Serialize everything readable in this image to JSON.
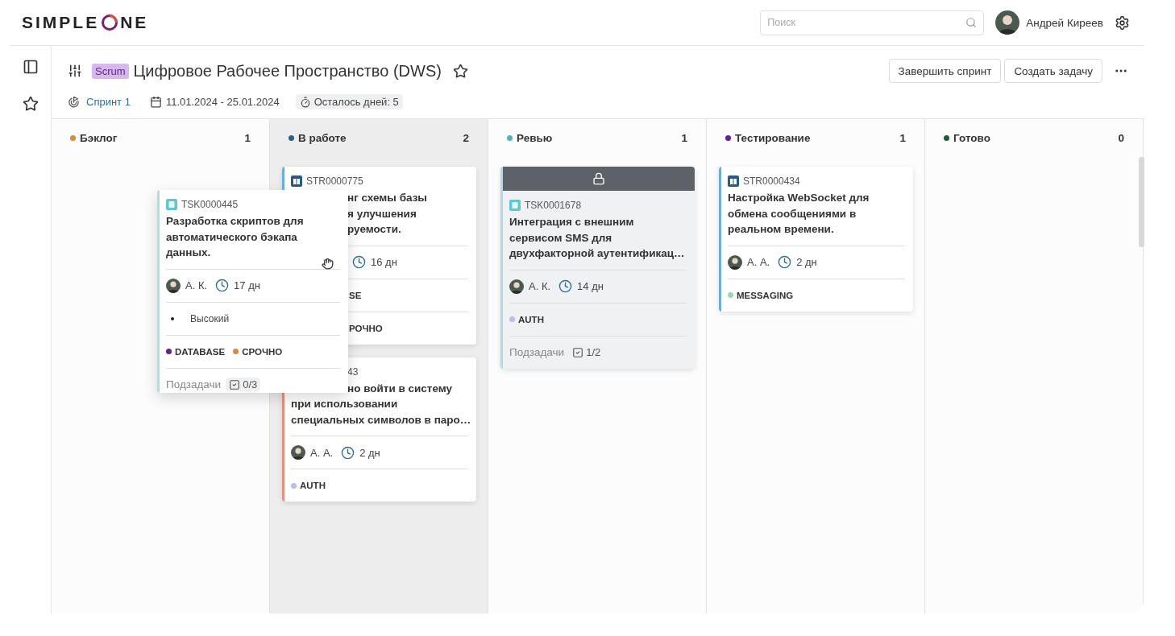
{
  "logo": {
    "before": "SIMPLE",
    "after": "NE"
  },
  "search": {
    "placeholder": "Поиск"
  },
  "user": {
    "name": "Андрей Киреев"
  },
  "project": {
    "badge": "Scrum",
    "title": "Цифровое Рабочее Пространство (DWS)",
    "sprint": "Спринт 1",
    "dates": "11.01.2024 - 25.01.2024",
    "remaining": "Осталось дней: 5"
  },
  "buttons": [
    "Завершить спринт",
    "Создать задачу"
  ],
  "columns": [
    {
      "name": "Бэклог",
      "count": "1",
      "color": "#d98c35",
      "highlighted": false
    },
    {
      "name": "В работе",
      "count": "2",
      "color": "#2f5d8a",
      "highlighted": true,
      "cards": [
        {
          "kind": "story",
          "id": "STR0000775",
          "color": "#6aaee0",
          "locked": false,
          "title_lines": [
            {
              "text": "нг схемы базы",
              "cut": true
            },
            {
              "text": "я улучшения",
              "cut": true
            },
            {
              "text": "руемости.",
              "cut": true
            }
          ],
          "rows": [
            {
              "kind": "meta",
              "cut": true,
              "duration": "16 дн"
            },
            {
              "kind": "tags",
              "cut": true,
              "tags": [
                {
                  "label": "SE"
                }
              ]
            },
            {
              "kind": "tags",
              "cut": true,
              "tags": [
                {
                  "label": "РОЧНО"
                }
              ]
            }
          ]
        },
        {
          "id": "43",
          "id_cut": true,
          "color": "#e8907a",
          "locked": false,
          "title_lines": [
            {
              "text": "но войти в систему",
              "cut": true
            },
            {
              "text": "при использовании"
            },
            {
              "text": "специальных символов в паро…"
            }
          ],
          "rows": [
            {
              "kind": "meta",
              "assignee": "А. А.",
              "duration": "2 дн"
            },
            {
              "kind": "tags",
              "tags": [
                {
                  "label": "AUTH",
                  "color": "#b7bdf0"
                }
              ]
            }
          ]
        }
      ]
    },
    {
      "name": "Ревью",
      "count": "1",
      "color": "#4bb3c8",
      "highlighted": false,
      "cards": [
        {
          "kind": "task",
          "id": "TSK0001678",
          "color": "#a8e0ea",
          "locked": true,
          "title_lines": [
            {
              "text": "Интеграция с внешним"
            },
            {
              "text": "сервисом SMS для"
            },
            {
              "text": "двухфакторной аутентификац…"
            }
          ],
          "rows": [
            {
              "kind": "meta",
              "assignee": "А. К.",
              "duration": "14 дн"
            },
            {
              "kind": "tags",
              "tags": [
                {
                  "label": "AUTH",
                  "color": "#b7bdf0"
                }
              ]
            },
            {
              "kind": "subtasks",
              "label": "Подзадачи",
              "value": "1/2"
            }
          ]
        }
      ]
    },
    {
      "name": "Тестирование",
      "count": "1",
      "color": "#6a1b9a",
      "highlighted": false,
      "cards": [
        {
          "kind": "story",
          "id": "STR0000434",
          "color": "#6aaee0",
          "locked": false,
          "title_lines": [
            {
              "text": "Настройка WebSocket для"
            },
            {
              "text": "обмена сообщениями в"
            },
            {
              "text": "реальном времени."
            }
          ],
          "rows": [
            {
              "kind": "meta",
              "assignee": "А. А.",
              "duration": "2 дн"
            },
            {
              "kind": "tags",
              "tags": [
                {
                  "label": "MESSAGING",
                  "color": "#8fdcb0"
                }
              ]
            }
          ]
        }
      ]
    },
    {
      "name": "Готово",
      "count": "0",
      "color": "#1f5c3a",
      "highlighted": false
    }
  ],
  "dragged_card": {
    "kind": "task",
    "id": "TSK0000445",
    "color": "#a8e0ea",
    "locked": false,
    "title_lines": [
      {
        "text": "Разработка скриптов для"
      },
      {
        "text": "автоматического бэкапа"
      },
      {
        "text": "данных."
      }
    ],
    "rows": [
      {
        "kind": "meta",
        "assignee": "А. К.",
        "duration": "17 дн"
      },
      {
        "kind": "priority",
        "label": "Высокий"
      },
      {
        "kind": "tags",
        "tags": [
          {
            "label": "DATABASE",
            "color": "#6a1b9a"
          },
          {
            "label": "СРОЧНО",
            "color": "#d98c35"
          }
        ]
      },
      {
        "kind": "subtasks",
        "label": "Подзадачи",
        "value": "0/3"
      }
    ]
  }
}
